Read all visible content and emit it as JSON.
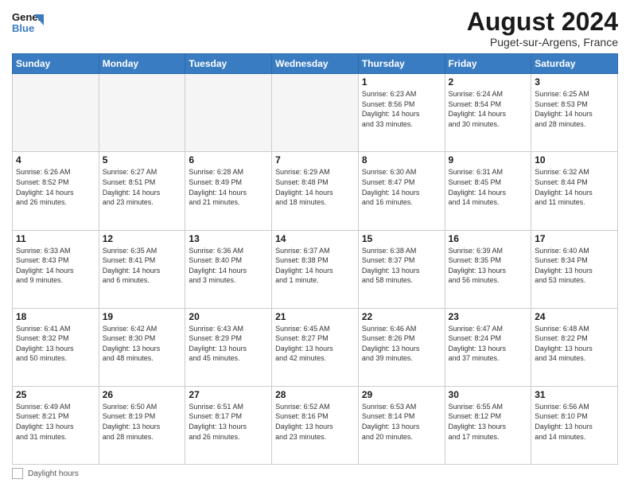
{
  "logo": {
    "line1": "General",
    "line2": "Blue"
  },
  "title": "August 2024",
  "subtitle": "Puget-sur-Argens, France",
  "weekdays": [
    "Sunday",
    "Monday",
    "Tuesday",
    "Wednesday",
    "Thursday",
    "Friday",
    "Saturday"
  ],
  "footer_label": "Daylight hours",
  "weeks": [
    [
      {
        "day": "",
        "info": "",
        "empty": true
      },
      {
        "day": "",
        "info": "",
        "empty": true
      },
      {
        "day": "",
        "info": "",
        "empty": true
      },
      {
        "day": "",
        "info": "",
        "empty": true
      },
      {
        "day": "1",
        "info": "Sunrise: 6:23 AM\nSunset: 8:56 PM\nDaylight: 14 hours\nand 33 minutes."
      },
      {
        "day": "2",
        "info": "Sunrise: 6:24 AM\nSunset: 8:54 PM\nDaylight: 14 hours\nand 30 minutes."
      },
      {
        "day": "3",
        "info": "Sunrise: 6:25 AM\nSunset: 8:53 PM\nDaylight: 14 hours\nand 28 minutes."
      }
    ],
    [
      {
        "day": "4",
        "info": "Sunrise: 6:26 AM\nSunset: 8:52 PM\nDaylight: 14 hours\nand 26 minutes."
      },
      {
        "day": "5",
        "info": "Sunrise: 6:27 AM\nSunset: 8:51 PM\nDaylight: 14 hours\nand 23 minutes."
      },
      {
        "day": "6",
        "info": "Sunrise: 6:28 AM\nSunset: 8:49 PM\nDaylight: 14 hours\nand 21 minutes."
      },
      {
        "day": "7",
        "info": "Sunrise: 6:29 AM\nSunset: 8:48 PM\nDaylight: 14 hours\nand 18 minutes."
      },
      {
        "day": "8",
        "info": "Sunrise: 6:30 AM\nSunset: 8:47 PM\nDaylight: 14 hours\nand 16 minutes."
      },
      {
        "day": "9",
        "info": "Sunrise: 6:31 AM\nSunset: 8:45 PM\nDaylight: 14 hours\nand 14 minutes."
      },
      {
        "day": "10",
        "info": "Sunrise: 6:32 AM\nSunset: 8:44 PM\nDaylight: 14 hours\nand 11 minutes."
      }
    ],
    [
      {
        "day": "11",
        "info": "Sunrise: 6:33 AM\nSunset: 8:43 PM\nDaylight: 14 hours\nand 9 minutes."
      },
      {
        "day": "12",
        "info": "Sunrise: 6:35 AM\nSunset: 8:41 PM\nDaylight: 14 hours\nand 6 minutes."
      },
      {
        "day": "13",
        "info": "Sunrise: 6:36 AM\nSunset: 8:40 PM\nDaylight: 14 hours\nand 3 minutes."
      },
      {
        "day": "14",
        "info": "Sunrise: 6:37 AM\nSunset: 8:38 PM\nDaylight: 14 hours\nand 1 minute."
      },
      {
        "day": "15",
        "info": "Sunrise: 6:38 AM\nSunset: 8:37 PM\nDaylight: 13 hours\nand 58 minutes."
      },
      {
        "day": "16",
        "info": "Sunrise: 6:39 AM\nSunset: 8:35 PM\nDaylight: 13 hours\nand 56 minutes."
      },
      {
        "day": "17",
        "info": "Sunrise: 6:40 AM\nSunset: 8:34 PM\nDaylight: 13 hours\nand 53 minutes."
      }
    ],
    [
      {
        "day": "18",
        "info": "Sunrise: 6:41 AM\nSunset: 8:32 PM\nDaylight: 13 hours\nand 50 minutes."
      },
      {
        "day": "19",
        "info": "Sunrise: 6:42 AM\nSunset: 8:30 PM\nDaylight: 13 hours\nand 48 minutes."
      },
      {
        "day": "20",
        "info": "Sunrise: 6:43 AM\nSunset: 8:29 PM\nDaylight: 13 hours\nand 45 minutes."
      },
      {
        "day": "21",
        "info": "Sunrise: 6:45 AM\nSunset: 8:27 PM\nDaylight: 13 hours\nand 42 minutes."
      },
      {
        "day": "22",
        "info": "Sunrise: 6:46 AM\nSunset: 8:26 PM\nDaylight: 13 hours\nand 39 minutes."
      },
      {
        "day": "23",
        "info": "Sunrise: 6:47 AM\nSunset: 8:24 PM\nDaylight: 13 hours\nand 37 minutes."
      },
      {
        "day": "24",
        "info": "Sunrise: 6:48 AM\nSunset: 8:22 PM\nDaylight: 13 hours\nand 34 minutes."
      }
    ],
    [
      {
        "day": "25",
        "info": "Sunrise: 6:49 AM\nSunset: 8:21 PM\nDaylight: 13 hours\nand 31 minutes."
      },
      {
        "day": "26",
        "info": "Sunrise: 6:50 AM\nSunset: 8:19 PM\nDaylight: 13 hours\nand 28 minutes."
      },
      {
        "day": "27",
        "info": "Sunrise: 6:51 AM\nSunset: 8:17 PM\nDaylight: 13 hours\nand 26 minutes."
      },
      {
        "day": "28",
        "info": "Sunrise: 6:52 AM\nSunset: 8:16 PM\nDaylight: 13 hours\nand 23 minutes."
      },
      {
        "day": "29",
        "info": "Sunrise: 6:53 AM\nSunset: 8:14 PM\nDaylight: 13 hours\nand 20 minutes."
      },
      {
        "day": "30",
        "info": "Sunrise: 6:55 AM\nSunset: 8:12 PM\nDaylight: 13 hours\nand 17 minutes."
      },
      {
        "day": "31",
        "info": "Sunrise: 6:56 AM\nSunset: 8:10 PM\nDaylight: 13 hours\nand 14 minutes."
      }
    ]
  ]
}
